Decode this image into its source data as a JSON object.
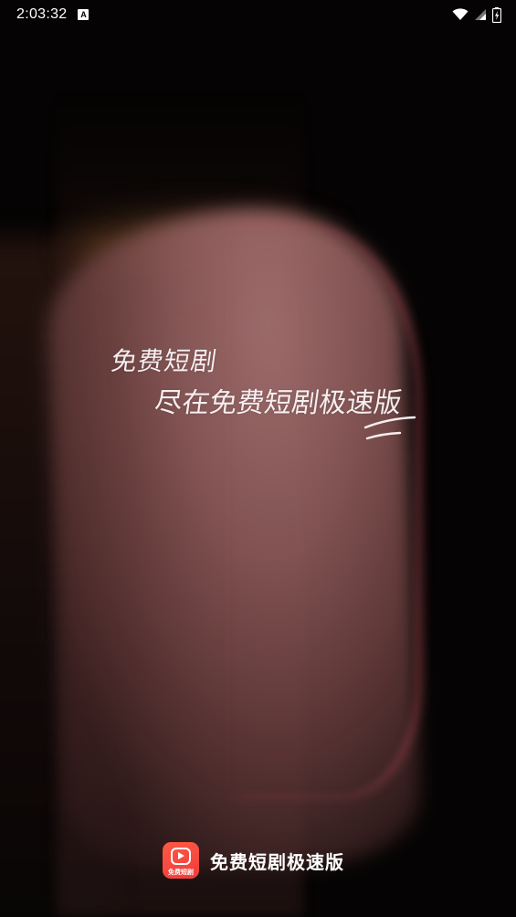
{
  "status_bar": {
    "time": "2:03:32",
    "notification_icon_letter": "A",
    "icons": [
      "wifi-icon",
      "cellular-signal-icon",
      "battery-charging-icon"
    ]
  },
  "slogan": {
    "line1": "免费短剧",
    "line2": "尽在免费短剧极速版"
  },
  "brand": {
    "app_name": "免费短剧极速版",
    "logo_text": "免费短剧",
    "logo_color": "#f04a3e"
  }
}
